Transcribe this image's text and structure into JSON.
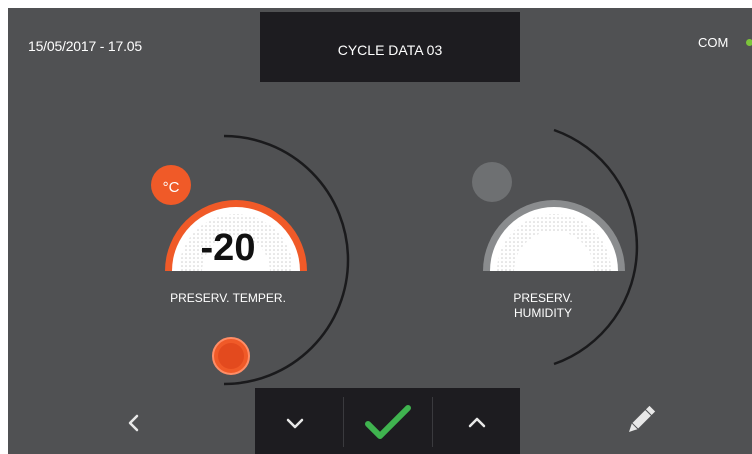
{
  "header": {
    "datetime": "15/05/2017 - 17.05",
    "title": "CYCLE DATA 03",
    "com_label": "COM",
    "com_status_color": "#7cc43a"
  },
  "dials": [
    {
      "label": "PRESERV. TEMPER.",
      "value": "-20",
      "unit": "°C",
      "active": true,
      "accent_color": "#f05a28"
    },
    {
      "label_line1": "PRESERV.",
      "label_line2": "HUMIDITY",
      "active": false,
      "accent_color": "#8a8c8e"
    }
  ],
  "toolbar": {
    "back_icon": "chevron-left-icon",
    "down_icon": "chevron-down-icon",
    "confirm_icon": "checkmark-icon",
    "confirm_color": "#3fb34f",
    "up_icon": "chevron-up-icon",
    "edit_icon": "pencil-icon"
  }
}
